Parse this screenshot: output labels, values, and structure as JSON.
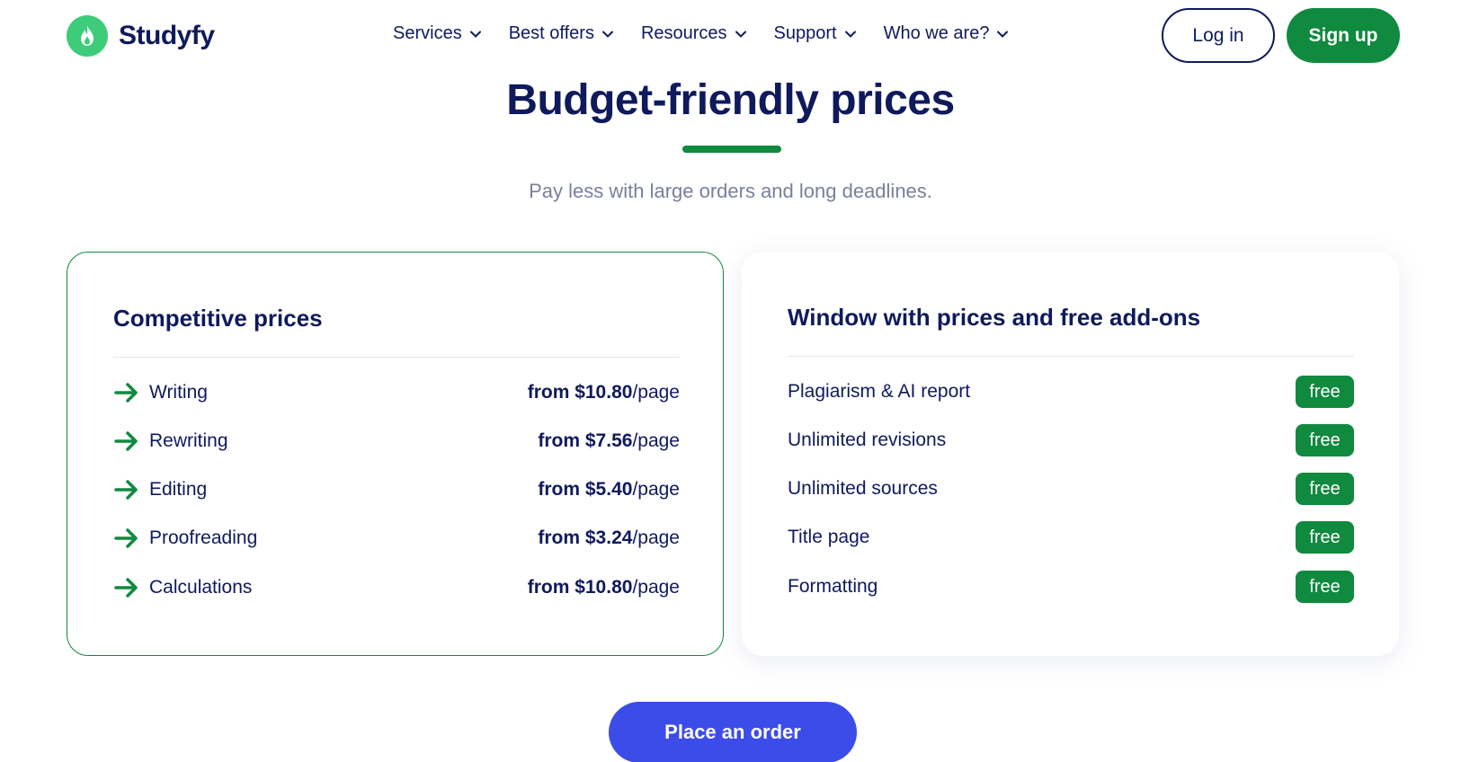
{
  "header": {
    "brand": "Studyfy",
    "nav": [
      {
        "label": "Services"
      },
      {
        "label": "Best offers"
      },
      {
        "label": "Resources"
      },
      {
        "label": "Support"
      },
      {
        "label": "Who we are?"
      }
    ],
    "login_label": "Log in",
    "signup_label": "Sign up"
  },
  "main": {
    "title": "Budget-friendly prices",
    "subtitle": "Pay less with large orders and long deadlines.",
    "cta_label": "Place an order"
  },
  "prices_card": {
    "title": "Competitive prices",
    "unit": "/page",
    "items": [
      {
        "label": "Writing",
        "price": "from $10.80"
      },
      {
        "label": "Rewriting",
        "price": "from $7.56"
      },
      {
        "label": "Editing",
        "price": "from $5.40"
      },
      {
        "label": "Proofreading",
        "price": "from $3.24"
      },
      {
        "label": "Calculations",
        "price": "from $10.80"
      }
    ]
  },
  "addons_card": {
    "title": "Window with prices and free add-ons",
    "items": [
      {
        "label": "Plagiarism & AI report",
        "badge": "free"
      },
      {
        "label": "Unlimited revisions",
        "badge": "free"
      },
      {
        "label": "Unlimited sources",
        "badge": "free"
      },
      {
        "label": "Title page",
        "badge": "free"
      },
      {
        "label": "Formatting",
        "badge": "free"
      }
    ]
  },
  "colors": {
    "navy": "#0f1a5c",
    "green": "#0f8a3e",
    "logo_green": "#3dcc7a",
    "cta_blue": "#3b4ce8",
    "muted": "#7a7f9c"
  },
  "icons": {
    "logo": "flame-icon",
    "nav_chevron": "chevron-down-icon",
    "row_marker": "arrow-right-icon"
  }
}
